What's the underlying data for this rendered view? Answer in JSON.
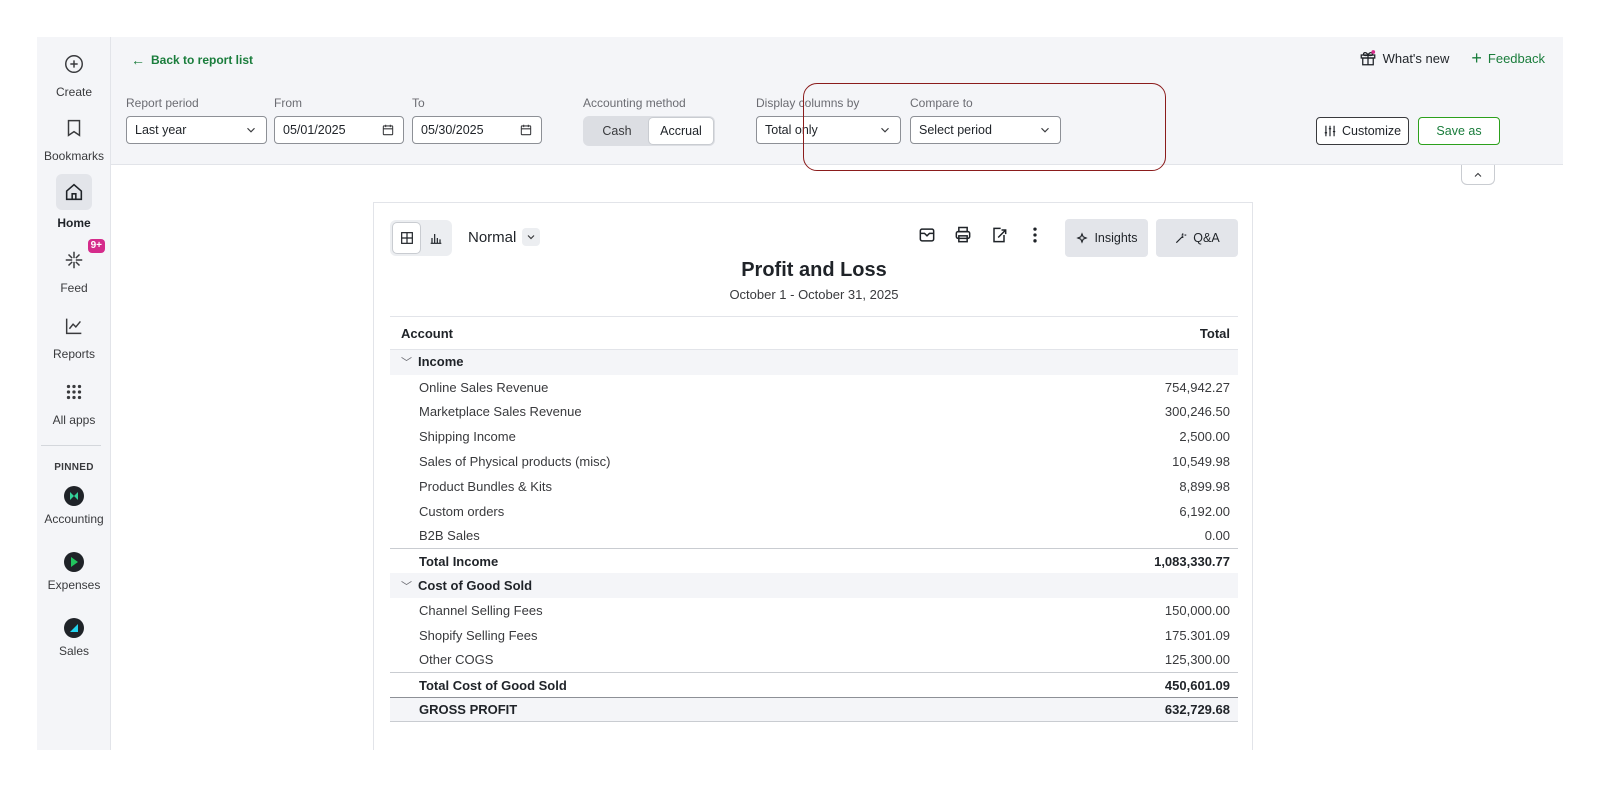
{
  "sidebar": {
    "items": [
      {
        "label": "Create",
        "icon": "plus-circle-icon"
      },
      {
        "label": "Bookmarks",
        "icon": "bookmark-icon"
      },
      {
        "label": "Home",
        "icon": "home-icon"
      },
      {
        "label": "Feed",
        "icon": "sparkle-icon",
        "badge": "9+"
      },
      {
        "label": "Reports",
        "icon": "line-chart-icon"
      },
      {
        "label": "All apps",
        "icon": "grid-icon"
      }
    ],
    "pinned_label": "PINNED",
    "pinned": [
      {
        "label": "Accounting",
        "icon": "accounting-icon"
      },
      {
        "label": "Expenses",
        "icon": "expenses-icon"
      },
      {
        "label": "Sales",
        "icon": "sales-icon"
      }
    ]
  },
  "header": {
    "back_label": "Back to report list",
    "whats_new": "What's new",
    "feedback": "Feedback",
    "report_period_label": "Report period",
    "report_period_value": "Last year",
    "from_label": "From",
    "from_value": "05/01/2025",
    "to_label": "To",
    "to_value": "05/30/2025",
    "accounting_method_label": "Accounting method",
    "method_cash": "Cash",
    "method_accrual": "Accrual",
    "display_columns_label": "Display columns by",
    "display_columns_value": "Total only",
    "compare_to_label": "Compare to",
    "compare_to_value": "Select period",
    "customize_label": "Customize",
    "save_as_label": "Save as"
  },
  "report": {
    "view_mode": "Normal",
    "insights_label": "Insights",
    "qa_label": "Q&A",
    "title": "Profit and Loss",
    "subtitle": "October 1 - October 31, 2025",
    "col_account": "Account",
    "col_total": "Total",
    "income_label": "Income",
    "income_items": [
      {
        "name": "Online Sales Revenue",
        "value": "754,942.27"
      },
      {
        "name": "Marketplace Sales Revenue",
        "value": "300,246.50"
      },
      {
        "name": "Shipping Income",
        "value": "2,500.00"
      },
      {
        "name": "Sales of Physical products (misc)",
        "value": "10,549.98"
      },
      {
        "name": "Product Bundles & Kits",
        "value": "8,899.98"
      },
      {
        "name": "Custom orders",
        "value": "6,192.00"
      },
      {
        "name": "B2B Sales",
        "value": "0.00"
      }
    ],
    "total_income_label": "Total Income",
    "total_income_value": "1,083,330.77",
    "cogs_label": "Cost of Good Sold",
    "cogs_items": [
      {
        "name": "Channel Selling Fees",
        "value": "150,000.00"
      },
      {
        "name": "Shopify Selling Fees",
        "value": "175.301.09"
      },
      {
        "name": "Other COGS",
        "value": "125,300.00"
      }
    ],
    "total_cogs_label": "Total Cost of Good Sold",
    "total_cogs_value": "450,601.09",
    "gross_profit_label": "GROSS PROFIT",
    "gross_profit_value": "632,729.68"
  },
  "colors": {
    "accent_green": "#2ca01c",
    "link_green": "#1a7d3c",
    "highlight_red": "#8b1c1c",
    "badge_pink": "#d52b8b"
  }
}
